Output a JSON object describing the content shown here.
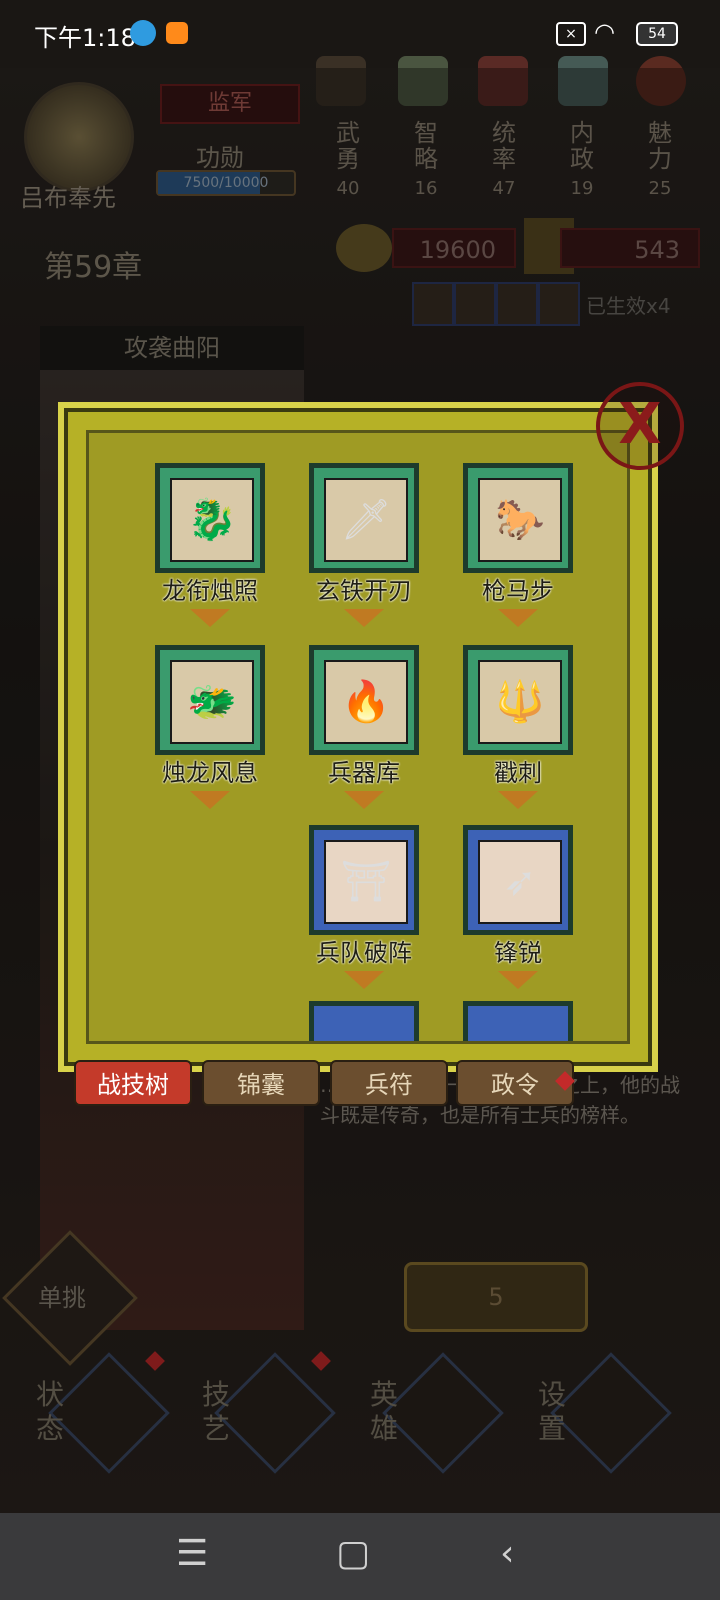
{
  "status_bar": {
    "time": "下午1:18",
    "battery": "54"
  },
  "hero": {
    "name": "吕布奉先",
    "rank": "监军",
    "merit_label": "功勋",
    "merit_value": "7500/10000",
    "merit_progress": 0.75
  },
  "attributes": [
    {
      "label": "武\n勇",
      "value": "40"
    },
    {
      "label": "智\n略",
      "value": "16"
    },
    {
      "label": "统\n率",
      "value": "47"
    },
    {
      "label": "内\n政",
      "value": "19"
    },
    {
      "label": "魅\n力",
      "value": "25"
    }
  ],
  "chapter": "第59章",
  "resources": {
    "coins": "19600",
    "grain": "543"
  },
  "buff_text": "已生效x4",
  "quest_title": "攻袭曲阳",
  "description": "…盖世，可谓一人之下万人之上，他的战斗既是传奇，也是所有士兵的榜样。",
  "battle_button_value": "5",
  "duel_label": "单挑",
  "bottom_nav": [
    {
      "label": "状\n态"
    },
    {
      "label": "技\n艺"
    },
    {
      "label": "英\n雄"
    },
    {
      "label": "设\n置"
    }
  ],
  "dialog": {
    "close_label": "X",
    "skills": [
      {
        "name": "龙衔烛照",
        "color": "green",
        "icon": "dragon-candle-icon",
        "glyph": "🐉"
      },
      {
        "name": "玄铁开刃",
        "color": "green",
        "icon": "iron-blade-icon",
        "glyph": "🗡"
      },
      {
        "name": "枪马步",
        "color": "green",
        "icon": "cavalry-icon",
        "glyph": "🐎"
      },
      {
        "name": "烛龙风息",
        "color": "green",
        "icon": "dragon-wind-icon",
        "glyph": "🐲"
      },
      {
        "name": "兵器库",
        "color": "green",
        "icon": "armory-icon",
        "glyph": "🔥"
      },
      {
        "name": "戳刺",
        "color": "green",
        "icon": "spear-thrust-icon",
        "glyph": "🔱"
      },
      {
        "name": "兵队破阵",
        "color": "blue",
        "icon": "gate-icon",
        "glyph": "⛩"
      },
      {
        "name": "锋锐",
        "color": "blue",
        "icon": "spear-icon",
        "glyph": "➶"
      }
    ],
    "tabs": [
      {
        "label": "战技树",
        "active": true
      },
      {
        "label": "锦囊",
        "active": false
      },
      {
        "label": "兵符",
        "active": false
      },
      {
        "label": "政令",
        "active": false
      }
    ]
  }
}
